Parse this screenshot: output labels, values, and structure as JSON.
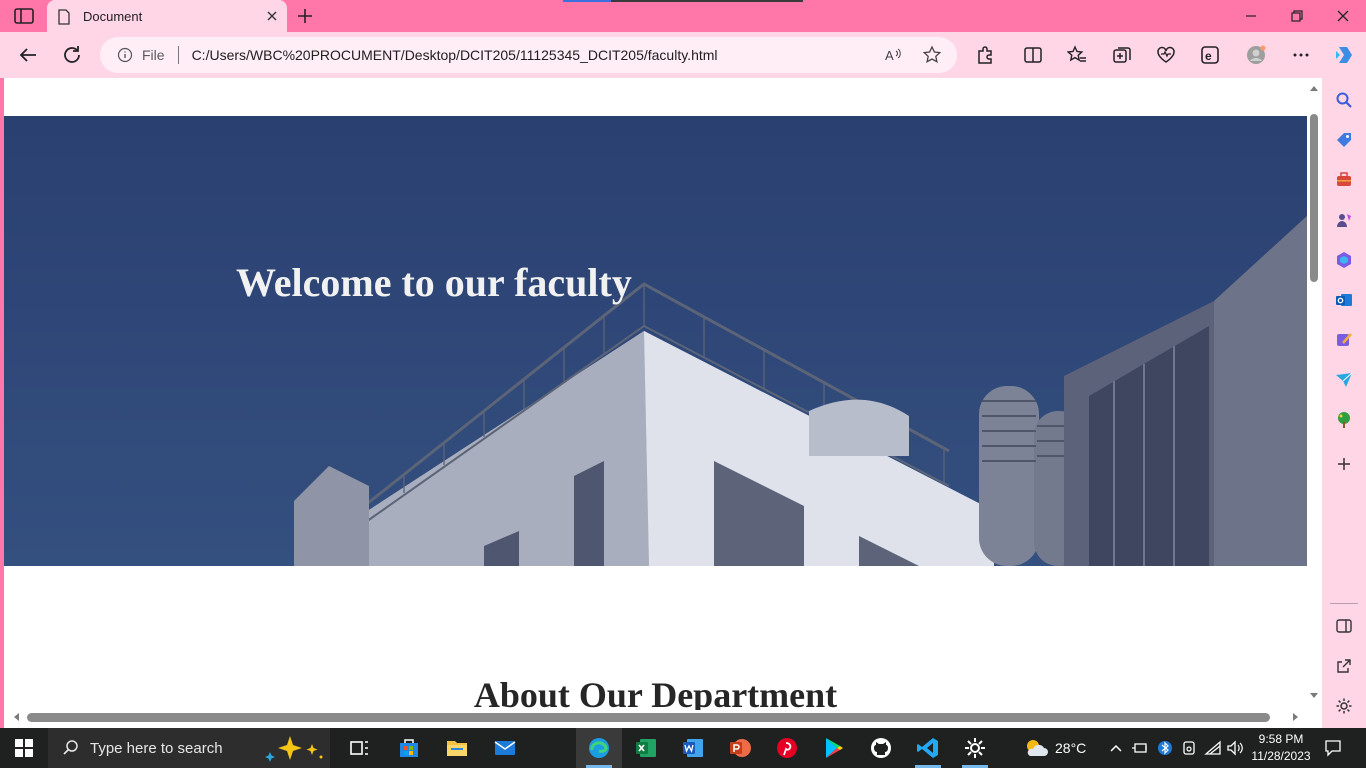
{
  "browser": {
    "tab_title": "Document",
    "address_prefix": "File",
    "url": "C:/Users/WBC%20PROCUMENT/Desktop/DCIT205/11125345_DCIT205/faculty.html"
  },
  "page": {
    "hero_title": "Welcome to our faculty",
    "section_heading": "About Our Department"
  },
  "taskbar": {
    "search_placeholder": "Type here to search",
    "weather": "28°C",
    "time": "9:58 PM",
    "date": "11/28/2023"
  },
  "colors": {
    "browser_frame": "#ff77a8",
    "toolbar": "#ffd6e6",
    "hero_overlay": "#2e4677",
    "taskbar": "#1f2020"
  }
}
